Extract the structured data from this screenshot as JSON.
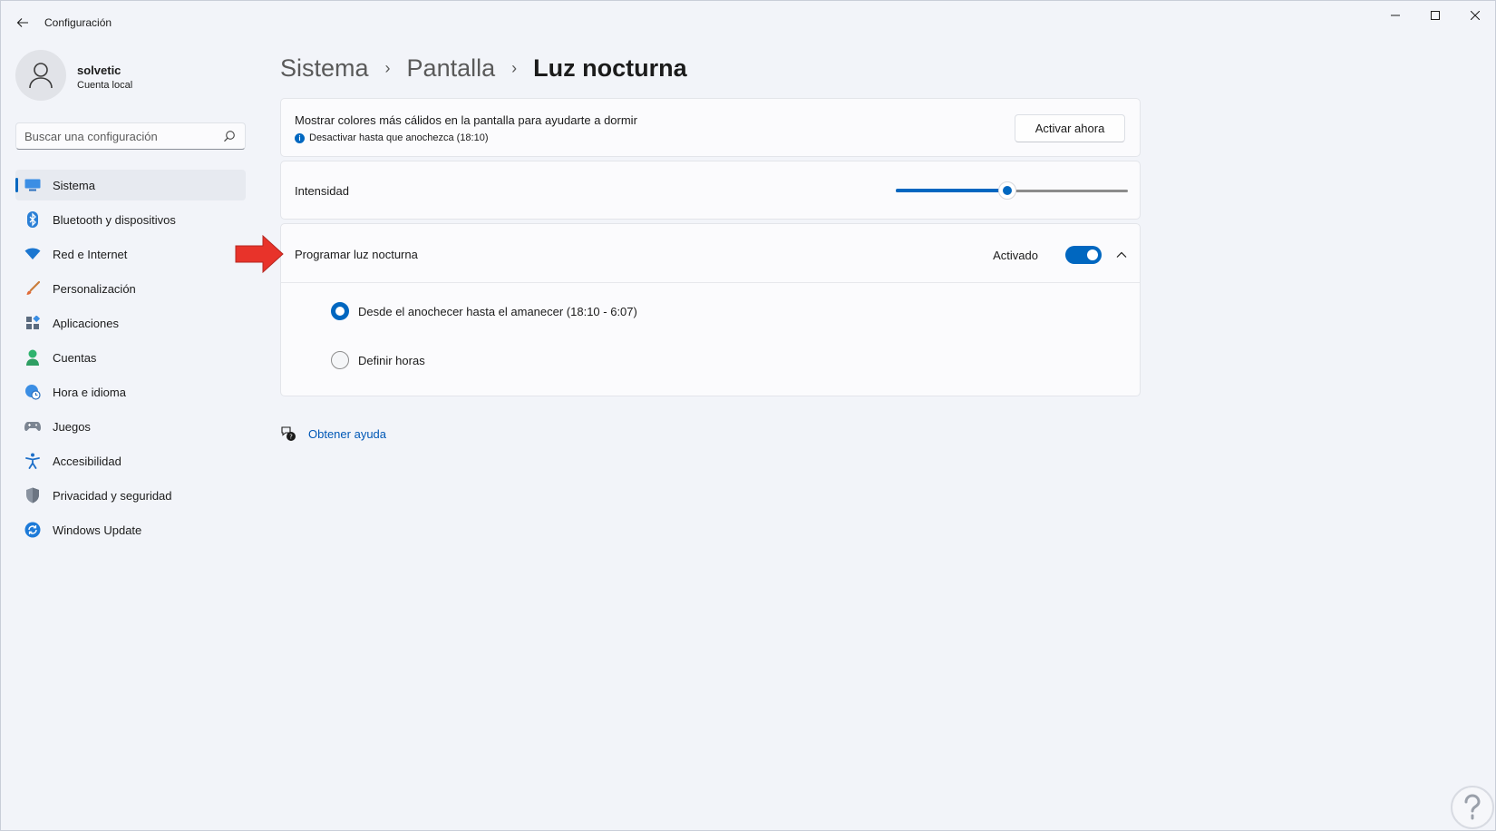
{
  "window": {
    "title": "Configuración"
  },
  "profile": {
    "name": "solvetic",
    "account_type": "Cuenta local"
  },
  "search": {
    "placeholder": "Buscar una configuración"
  },
  "sidebar": {
    "items": [
      {
        "label": "Sistema",
        "icon": "system-icon",
        "active": true
      },
      {
        "label": "Bluetooth y dispositivos",
        "icon": "bluetooth-icon"
      },
      {
        "label": "Red e Internet",
        "icon": "wifi-icon"
      },
      {
        "label": "Personalización",
        "icon": "brush-icon"
      },
      {
        "label": "Aplicaciones",
        "icon": "apps-icon"
      },
      {
        "label": "Cuentas",
        "icon": "person-icon"
      },
      {
        "label": "Hora e idioma",
        "icon": "globe-clock-icon"
      },
      {
        "label": "Juegos",
        "icon": "gamepad-icon"
      },
      {
        "label": "Accesibilidad",
        "icon": "accessibility-icon"
      },
      {
        "label": "Privacidad y seguridad",
        "icon": "shield-icon"
      },
      {
        "label": "Windows Update",
        "icon": "update-icon"
      }
    ]
  },
  "breadcrumb": {
    "level1": "Sistema",
    "level2": "Pantalla",
    "current": "Luz nocturna",
    "separator": "›"
  },
  "night_light": {
    "description": "Mostrar colores más cálidos en la pantalla para ayudarte a dormir",
    "status": "Desactivar hasta que anochezca (18:10)",
    "button_label": "Activar ahora"
  },
  "intensity": {
    "label": "Intensidad",
    "value_fraction": 0.48
  },
  "schedule": {
    "label": "Programar luz nocturna",
    "toggle_state": "Activado",
    "options": [
      {
        "label": "Desde el anochecer hasta el amanecer (18:10 - 6:07)",
        "selected": true
      },
      {
        "label": "Definir horas",
        "selected": false
      }
    ]
  },
  "help": {
    "label": "Obtener ayuda"
  },
  "colors": {
    "accent": "#0067c0",
    "annotation_arrow": "#e8332a"
  }
}
